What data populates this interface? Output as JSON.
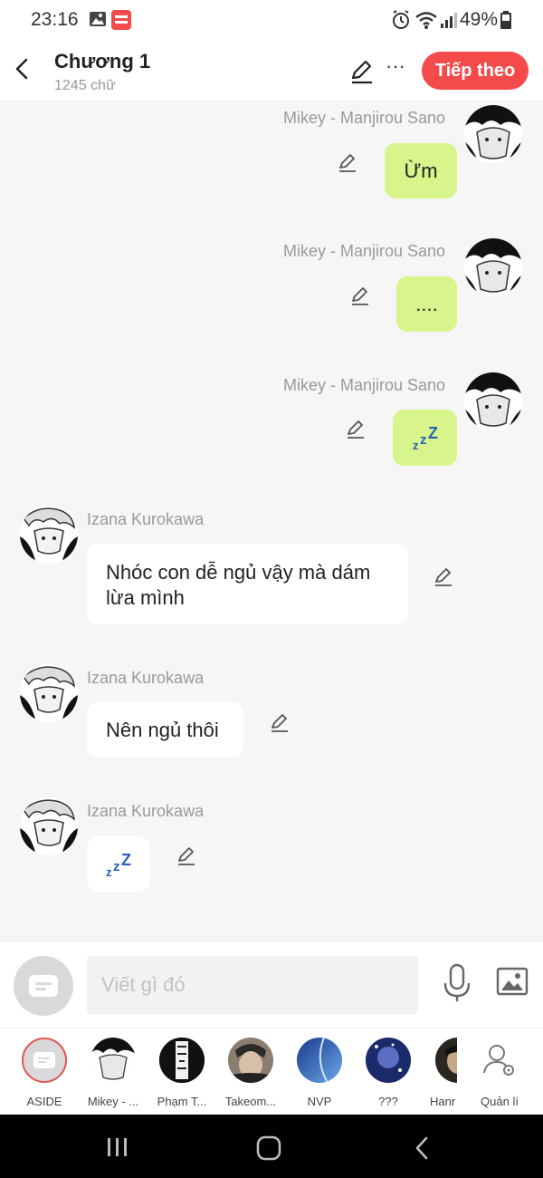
{
  "status_bar": {
    "time": "23:16",
    "battery": "49%"
  },
  "header": {
    "title": "Chương 1",
    "subtitle": "1245 chữ",
    "next_label": "Tiếp theo"
  },
  "messages": [
    {
      "sender": "Mikey - Manjirou Sano",
      "text": "Ừm",
      "side": "right"
    },
    {
      "sender": "Mikey - Manjirou Sano",
      "text": "....",
      "side": "right"
    },
    {
      "sender": "Mikey - Manjirou Sano",
      "text": "",
      "sticker": "sleep-zzz",
      "side": "right"
    },
    {
      "sender": "Izana Kurokawa",
      "text_line1": "Nhóc con dễ ngủ vậy mà dám",
      "text_line2": "lừa mình",
      "side": "left"
    },
    {
      "sender": "Izana Kurokawa",
      "text": "Nên ngủ thôi",
      "side": "left"
    },
    {
      "sender": "Izana Kurokawa",
      "text": "",
      "sticker": "sleep-zzz",
      "side": "left"
    }
  ],
  "input": {
    "placeholder": "Viết gì đó"
  },
  "characters": [
    {
      "label": "ASIDE"
    },
    {
      "label": "Mikey - ..."
    },
    {
      "label": "Phạm T..."
    },
    {
      "label": "Takeom..."
    },
    {
      "label": "NVP"
    },
    {
      "label": "???"
    },
    {
      "label": "Hanr"
    },
    {
      "label": "Quản lí"
    }
  ],
  "colors": {
    "accent": "#f44a4a",
    "bubble_green": "#d7f58a",
    "aside_red": "#e05555"
  },
  "icons": [
    "back-arrow",
    "pencil",
    "more-dots",
    "mic",
    "image",
    "manage-user",
    "zzz-sleep"
  ]
}
